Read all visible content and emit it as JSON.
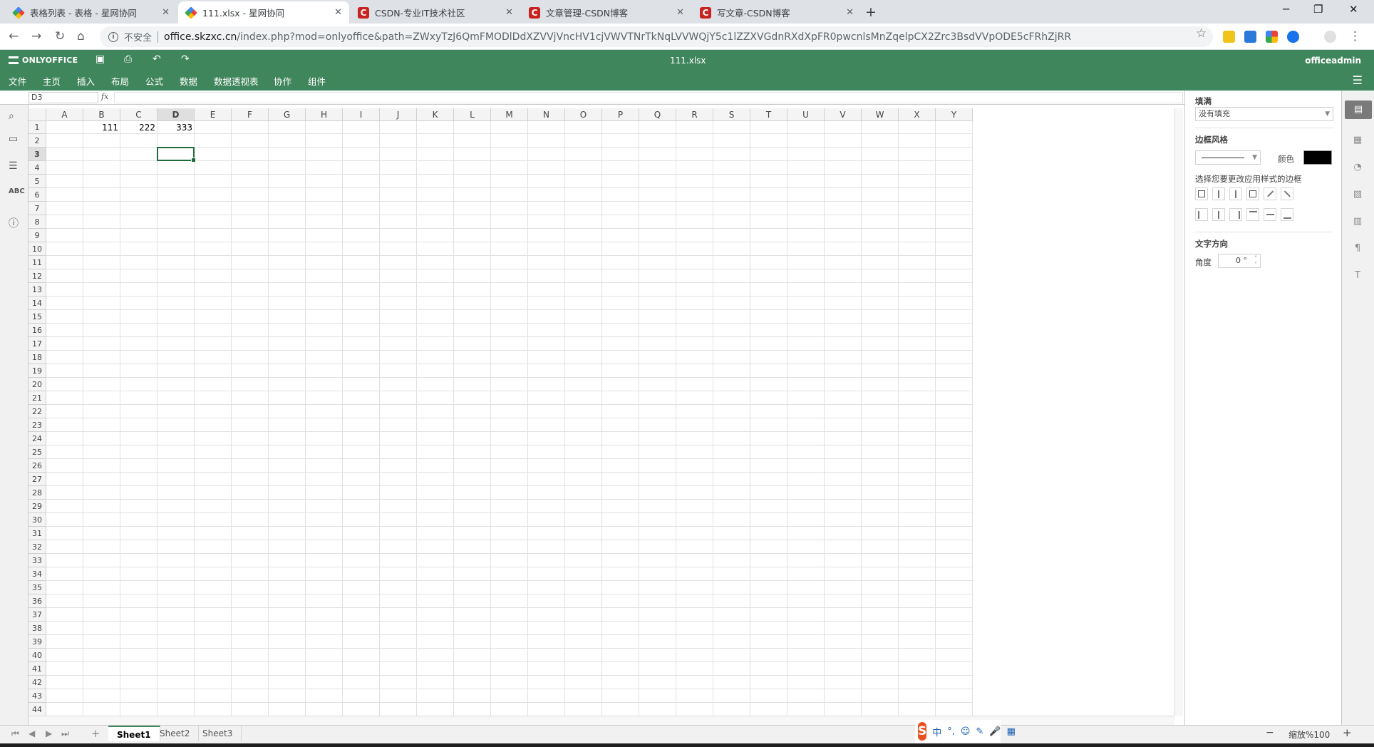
{
  "browser": {
    "tabs": [
      {
        "title": "表格列表 - 表格 - 星网协同",
        "favicon": "google-drive-icon",
        "active": false
      },
      {
        "title": "111.xlsx - 星网协同",
        "favicon": "google-drive-icon",
        "active": true
      },
      {
        "title": "CSDN-专业IT技术社区",
        "favicon": "csdn-icon",
        "active": false
      },
      {
        "title": "文章管理-CSDN博客",
        "favicon": "csdn-icon",
        "active": false
      },
      {
        "title": "写文章-CSDN博客",
        "favicon": "csdn-icon",
        "active": false
      }
    ],
    "insecure_label": "不安全",
    "url_host": "office.skzxc.cn",
    "url_path": "/index.php?mod=onlyoffice&path=ZWxyTzJ6QmFMODlDdXZVVjVncHV1cjVWVTNrTkNqLVVWQjY5c1lZZXVGdnRXdXpFR0pwcnlsMnZqelpCX2Zrc3BsdVVpODE5cFRhZjRR"
  },
  "editor": {
    "brand": "ONLYOFFICE",
    "doc_title": "111.xlsx",
    "user": "officeadmin",
    "menu": [
      "文件",
      "主页",
      "插入",
      "布局",
      "公式",
      "数据",
      "数据透视表",
      "协作",
      "组件"
    ],
    "name_box": "D3",
    "fx_label": "fx",
    "columns": [
      "A",
      "B",
      "C",
      "D",
      "E",
      "F",
      "G",
      "H",
      "I",
      "J",
      "K",
      "L",
      "M",
      "N",
      "O",
      "P",
      "Q",
      "R",
      "S",
      "T",
      "U",
      "V",
      "W",
      "X",
      "Y"
    ],
    "selected_col": "D",
    "selected_row": 3,
    "row_count": 44,
    "cells": [
      {
        "ref": "B1",
        "col": 1,
        "row": 1,
        "value": "111"
      },
      {
        "ref": "C1",
        "col": 2,
        "row": 1,
        "value": "222"
      },
      {
        "ref": "D1",
        "col": 3,
        "row": 1,
        "value": "333"
      }
    ],
    "sheets": [
      "Sheet1",
      "Sheet2",
      "Sheet3"
    ],
    "active_sheet": "Sheet1",
    "zoom_label": "缩放%100",
    "zoom_minus": "−",
    "zoom_plus": "+"
  },
  "panel": {
    "fill_title": "填满",
    "fill_value": "没有填充",
    "border_style_title": "边框风格",
    "color_label": "颜色",
    "border_color": "#000000",
    "border_hint": "选择您要更改应用样式的边框",
    "text_dir_title": "文字方向",
    "angle_label": "角度",
    "angle_value": "0 °"
  },
  "ime": {
    "items": [
      "中",
      "°,",
      "☺",
      "✎",
      "🎤",
      "▦"
    ]
  },
  "colors": {
    "accent": "#40865c",
    "selection": "#1e6a3a"
  }
}
